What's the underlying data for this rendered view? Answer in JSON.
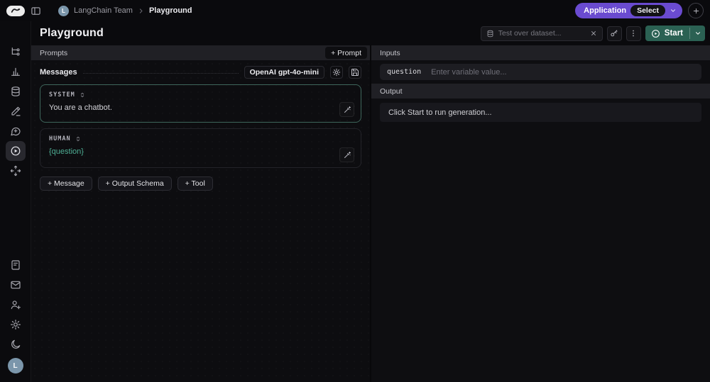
{
  "topbar": {
    "breadcrumb": {
      "avatar_letter": "L",
      "team": "LangChain Team",
      "page": "Playground"
    },
    "application_label": "Application",
    "select_label": "Select"
  },
  "sidebar": {
    "items_top": [
      "home",
      "tracing-projects",
      "monitoring",
      "datasets",
      "annotation-queues",
      "prompts",
      "playground",
      "deployments"
    ],
    "items_bottom": [
      "docs",
      "mail",
      "invite-user",
      "settings",
      "dark-mode"
    ],
    "active_item": "playground",
    "avatar_letter": "L"
  },
  "header": {
    "title": "Playground",
    "dataset_placeholder": "Test over dataset...",
    "start_label": "Start"
  },
  "prompts_panel": {
    "header": "Prompts",
    "add_prompt_label": "+ Prompt",
    "messages_label": "Messages",
    "model_label": "OpenAI gpt-4o-mini",
    "messages": [
      {
        "role": "SYSTEM",
        "content": "You are a chatbot."
      },
      {
        "role": "HUMAN",
        "content": "{question}"
      }
    ],
    "actions": [
      "+ Message",
      "+ Output Schema",
      "+ Tool"
    ]
  },
  "right_panel": {
    "inputs_header": "Inputs",
    "variable_name": "question",
    "variable_placeholder": "Enter variable value...",
    "output_header": "Output",
    "output_placeholder": "Click Start to run generation..."
  },
  "icons": {
    "topbar": [
      "langsmith-logo",
      "panel-toggle-icon",
      "chevron-down-icon",
      "plus-icon"
    ],
    "toolbar": [
      "database-icon",
      "close-icon",
      "key-icon",
      "dots-vertical-icon",
      "play-icon",
      "chevron-down-icon"
    ],
    "prompt": [
      "gear-icon",
      "save-icon",
      "chevrons-up-down-icon",
      "wand-icon"
    ]
  },
  "colors": {
    "accent-purple": "#6a4bd0",
    "start-teal": "#2b6153",
    "template-variable-teal": "#4fb096",
    "system-border-teal": "#3e665b",
    "avatar-blue": "#7b96ab"
  }
}
